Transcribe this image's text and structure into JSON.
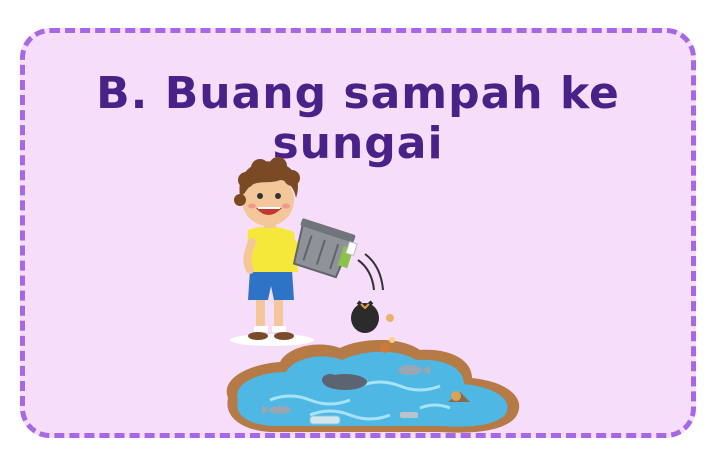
{
  "card": {
    "title_line1": "B. Buang sampah ke",
    "title_line2": "sungai",
    "colors": {
      "background": "#f6ddf9",
      "border": "#a867e6",
      "title": "#4a2287"
    }
  },
  "illustration": {
    "subject": "boy-dumping-trash-into-river",
    "icons": [
      "boy-icon",
      "trash-bin-icon",
      "garbage-bag-icon",
      "river-icon",
      "fish-icon",
      "bottle-icon"
    ]
  }
}
